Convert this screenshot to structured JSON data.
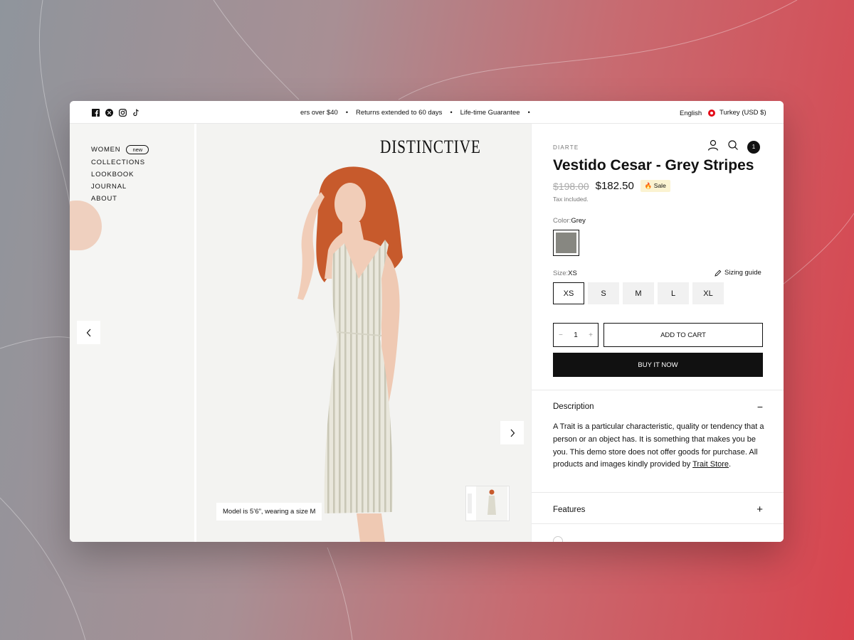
{
  "topbar": {
    "announcements": [
      "ers over $40",
      "Returns extended to 60 days",
      "Life-time Guarantee"
    ],
    "separator": "•",
    "language": "English",
    "currency": "Turkey (USD $)"
  },
  "nav": {
    "items": [
      {
        "label": "WOMEN",
        "badge": "new"
      },
      {
        "label": "COLLECTIONS"
      },
      {
        "label": "LOOKBOOK"
      },
      {
        "label": "JOURNAL"
      },
      {
        "label": "ABOUT"
      }
    ]
  },
  "brand": {
    "logo": "DISTINCTIVE"
  },
  "gallery": {
    "caption": "Model is 5’6”, wearing a size M"
  },
  "product": {
    "vendor": "DIARTE",
    "title": "Vestido Cesar - Grey Stripes",
    "compare_price": "$198.00",
    "price": "$182.50",
    "sale_badge": "🔥 Sale",
    "tax_note": "Tax included.",
    "color_label": "Color:",
    "color_value": "Grey",
    "swatch_color": "#878781",
    "size_label": "Size:",
    "size_value": "XS",
    "sizing_guide": "Sizing guide",
    "sizes": [
      "XS",
      "S",
      "M",
      "L",
      "XL"
    ],
    "quantity": "1",
    "qty_minus": "−",
    "qty_plus": "+",
    "add_to_cart": "ADD TO CART",
    "buy_now": "BUY IT NOW",
    "cart_count": "1"
  },
  "accordion": {
    "description_title": "Description",
    "description_toggle": "−",
    "description_text": "A Trait is a particular characteristic, quality or tendency that a person or an object has. It is something that makes you be you. This demo store does not offer goods for purchase. All products and images kindly provided by ",
    "description_link": "Trait Store",
    "description_end": ".",
    "features_title": "Features",
    "features_toggle": "+"
  }
}
